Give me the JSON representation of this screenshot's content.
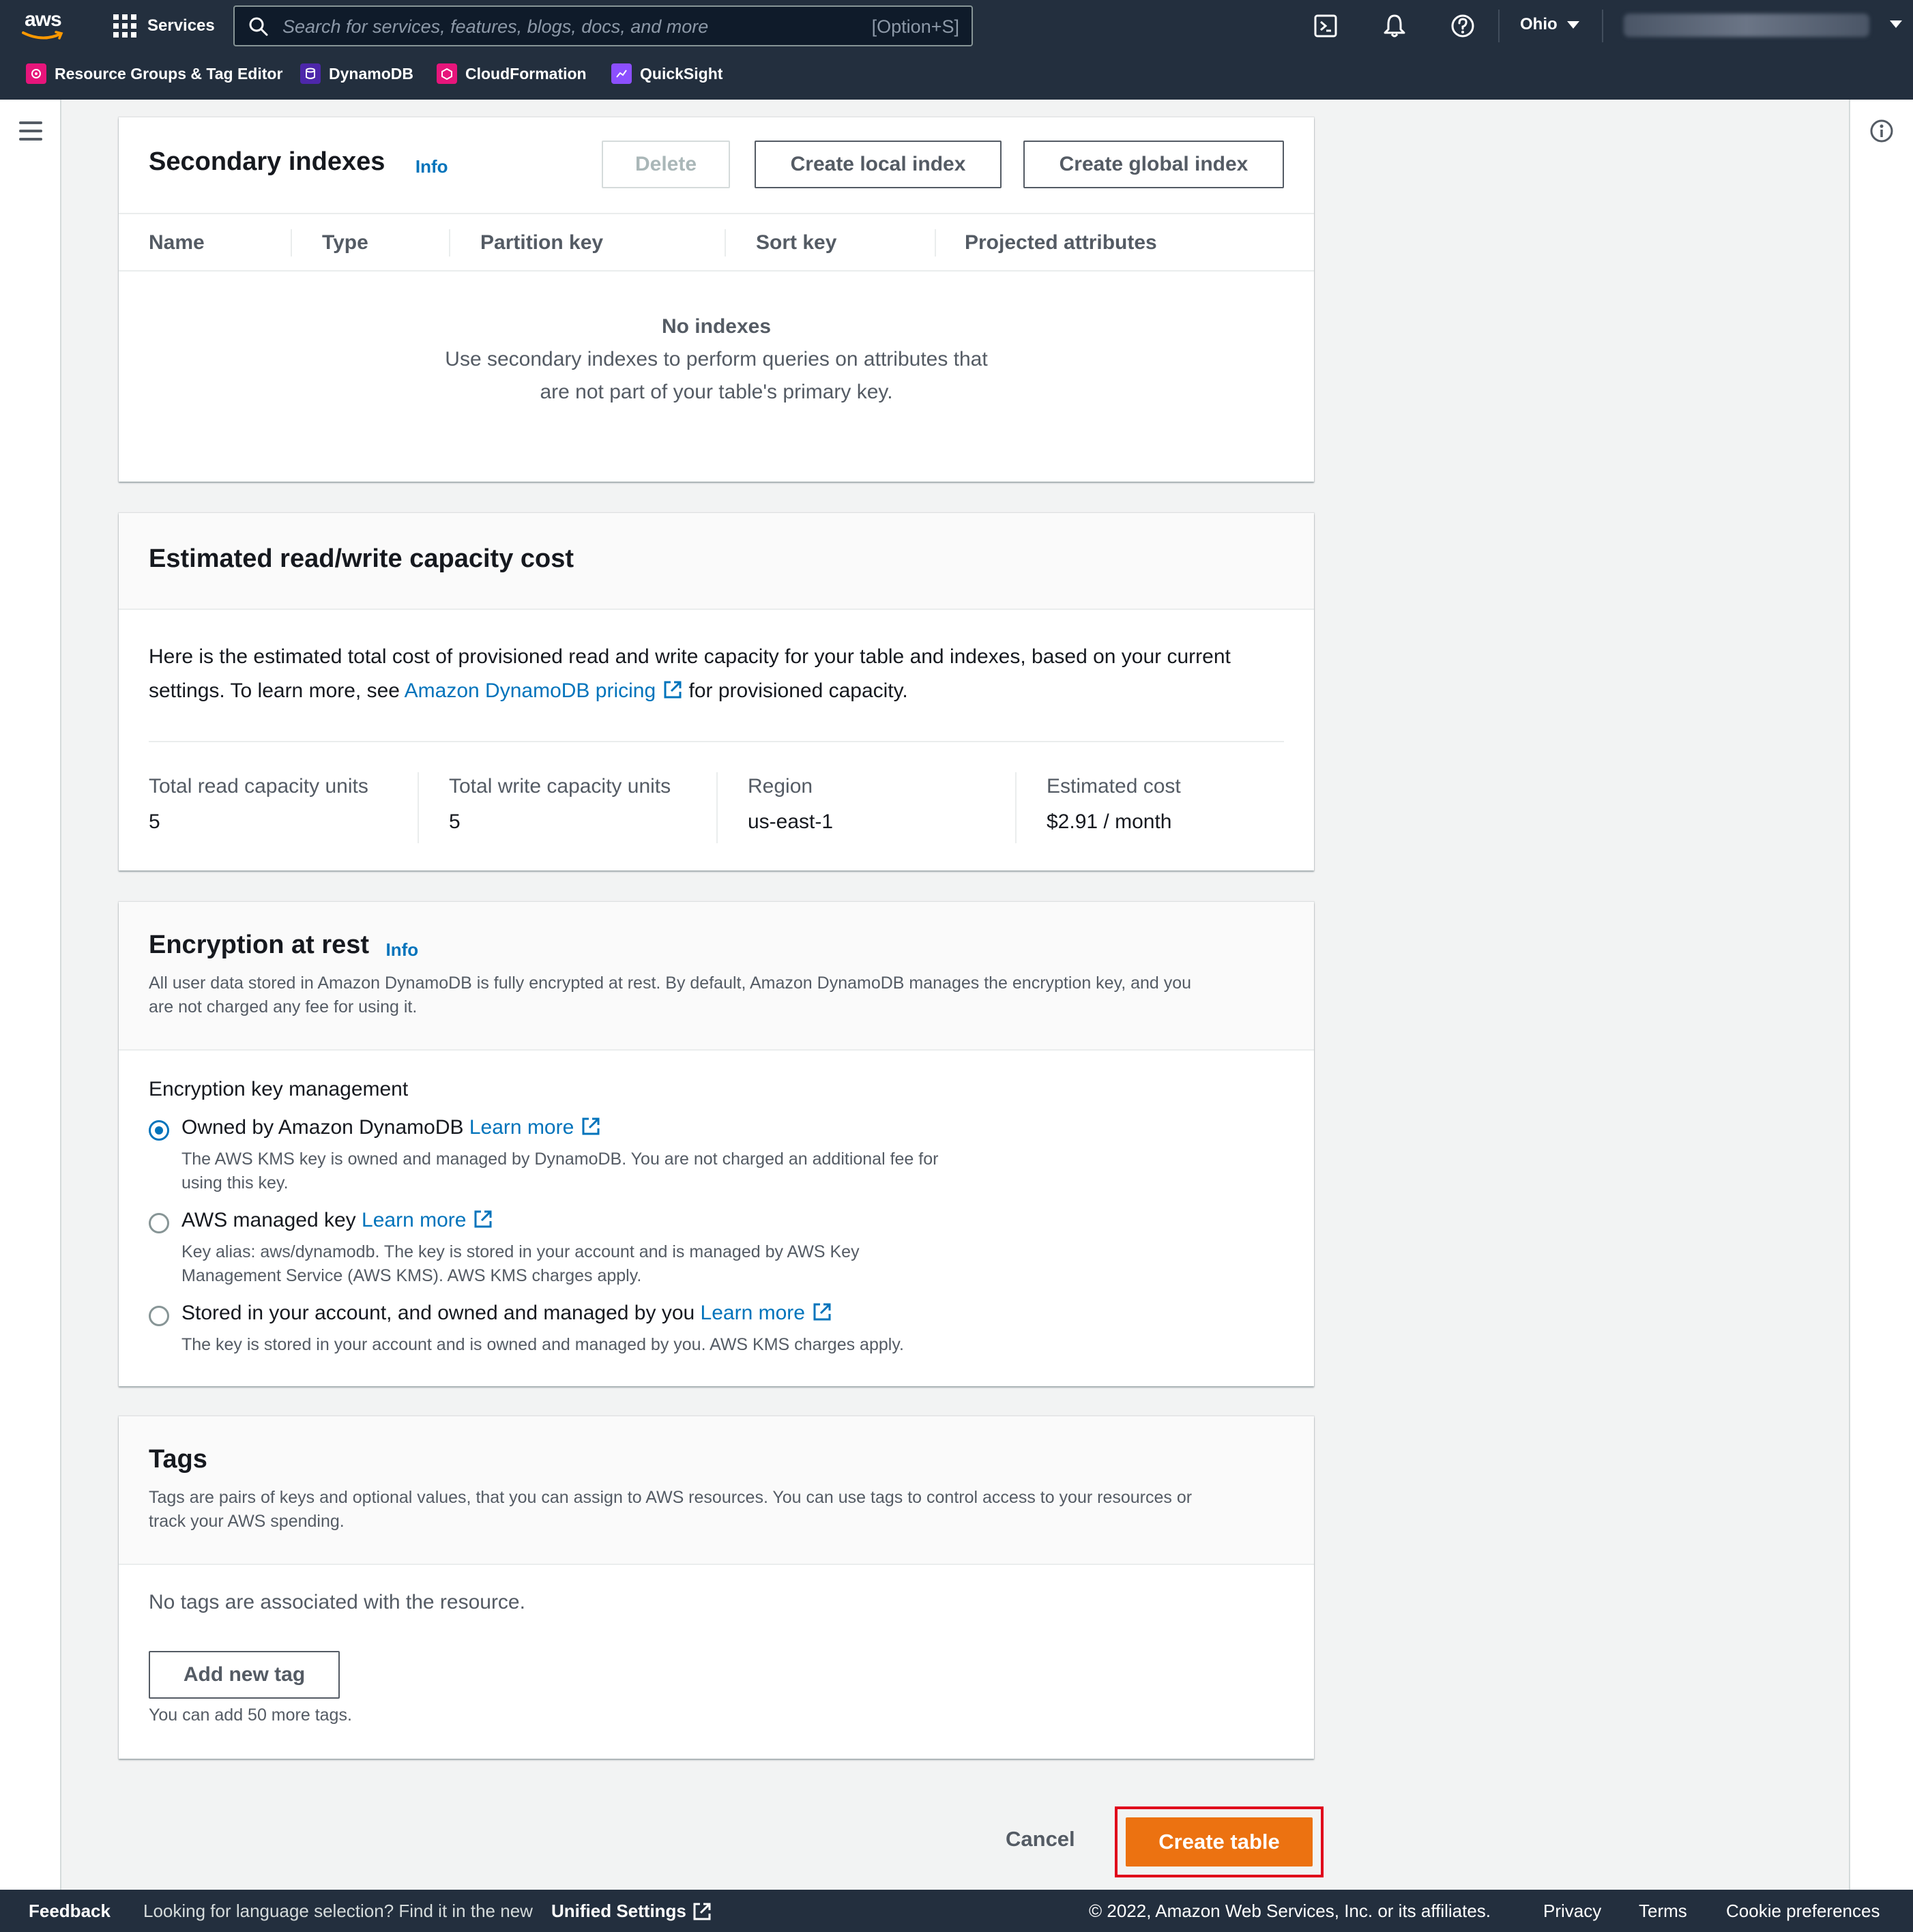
{
  "topbar": {
    "logo_text": "aws",
    "services_label": "Services",
    "search_placeholder": "Search for services, features, blogs, docs, and more",
    "search_shortcut": "[Option+S]",
    "region": "Ohio",
    "cloudshell_icon": "cloudshell-icon",
    "bell_icon": "bell-icon",
    "help_icon": "help-icon"
  },
  "favorites": [
    {
      "label": "Resource Groups & Tag Editor",
      "color": "#e7157b"
    },
    {
      "label": "DynamoDB",
      "color": "#4d27aa"
    },
    {
      "label": "CloudFormation",
      "color": "#e7157b"
    },
    {
      "label": "QuickSight",
      "color": "#8c4fff"
    }
  ],
  "secondary_indexes": {
    "title": "Secondary indexes",
    "info": "Info",
    "delete_label": "Delete",
    "create_local_label": "Create local index",
    "create_global_label": "Create global index",
    "columns": [
      "Name",
      "Type",
      "Partition key",
      "Sort key",
      "Projected attributes"
    ],
    "empty_title": "No indexes",
    "empty_line1": "Use secondary indexes to perform queries on attributes that",
    "empty_line2": "are not part of your table's primary key."
  },
  "capacity_cost": {
    "title": "Estimated read/write capacity cost",
    "text_part1": "Here is the estimated total cost of provisioned read and write capacity for your table and indexes, based on your current",
    "text_part2": "settings. To learn more, see",
    "pricing_link": "Amazon DynamoDB pricing",
    "text_part3": "for provisioned capacity.",
    "read_label": "Total read capacity units",
    "read_value": "5",
    "write_label": "Total write capacity units",
    "write_value": "5",
    "region_label": "Region",
    "region_value": "us-east-1",
    "cost_label": "Estimated cost",
    "cost_value": "$2.91 / month"
  },
  "encryption": {
    "title": "Encryption at rest",
    "info": "Info",
    "desc_line1": "All user data stored in Amazon DynamoDB is fully encrypted at rest. By default, Amazon DynamoDB manages the encryption key, and you",
    "desc_line2": "are not charged any fee for using it.",
    "key_mgmt_label": "Encryption key management",
    "learn_more": "Learn more",
    "options": [
      {
        "label": "Owned by Amazon DynamoDB",
        "desc1": "The AWS KMS key is owned and managed by DynamoDB. You are not charged an additional fee for",
        "desc2": "using this key.",
        "selected": true
      },
      {
        "label": "AWS managed key",
        "desc1": "Key alias: aws/dynamodb. The key is stored in your account and is managed by AWS Key",
        "desc2": "Management Service (AWS KMS). AWS KMS charges apply.",
        "selected": false
      },
      {
        "label": "Stored in your account, and owned and managed by you",
        "desc1": "The key is stored in your account and is owned and managed by you. AWS KMS charges apply.",
        "desc2": "",
        "selected": false
      }
    ]
  },
  "tags": {
    "title": "Tags",
    "desc_line1": "Tags are pairs of keys and optional values, that you can assign to AWS resources. You can use tags to control access to your resources or",
    "desc_line2": "track your AWS spending.",
    "empty_text": "No tags are associated with the resource.",
    "add_label": "Add new tag",
    "hint": "You can add 50 more tags."
  },
  "actions": {
    "cancel_label": "Cancel",
    "create_label": "Create table",
    "primary_color": "#ec7211",
    "highlight_color": "#e0001a"
  },
  "footer": {
    "feedback": "Feedback",
    "lang_text": "Looking for language selection? Find it in the new",
    "unified_settings": "Unified Settings",
    "copyright": "© 2022, Amazon Web Services, Inc. or its affiliates.",
    "privacy": "Privacy",
    "terms": "Terms",
    "cookies": "Cookie preferences"
  }
}
